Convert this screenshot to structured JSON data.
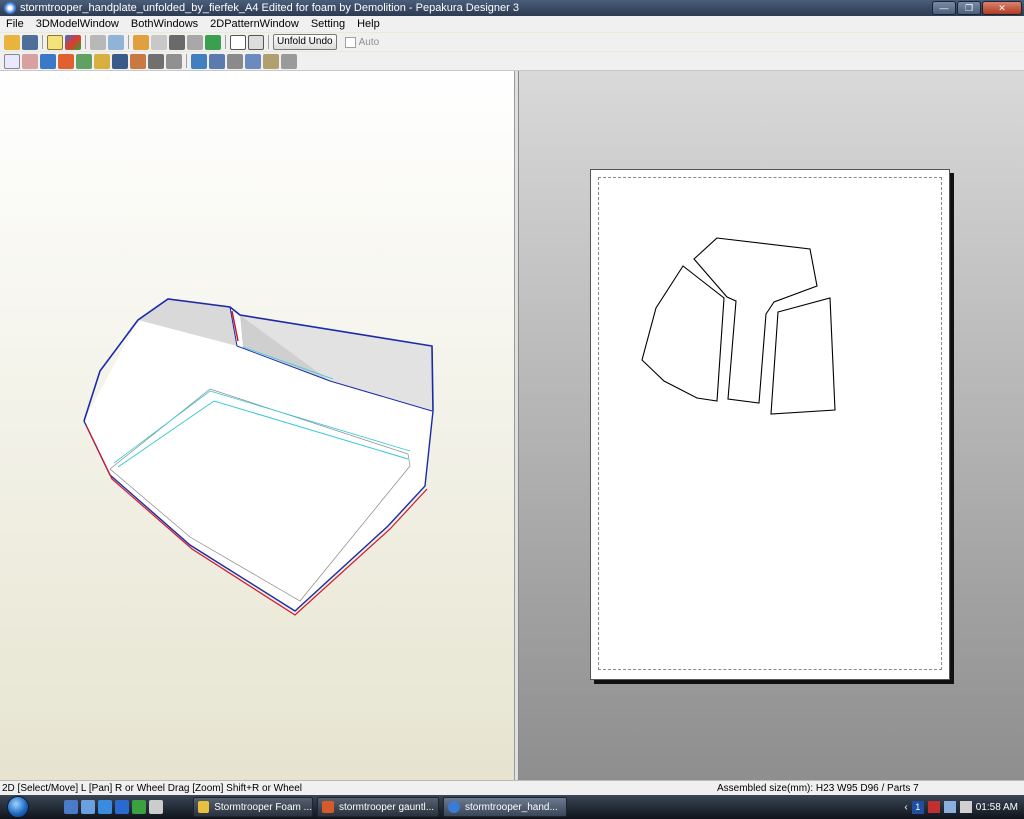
{
  "window": {
    "title": "stormtrooper_handplate_unfolded_by_fierfek_A4 Edited for foam by Demolition - Pepakura Designer 3"
  },
  "menu": [
    "File",
    "3DModelWindow",
    "BothWindows",
    "2DPatternWindow",
    "Setting",
    "Help"
  ],
  "toolbar": {
    "unfold_undo_label": "Unfold Undo",
    "auto_label": "Auto"
  },
  "status": {
    "left": "2D [Select/Move] L [Pan] R or Wheel Drag [Zoom] Shift+R or Wheel",
    "right": "Assembled size(mm): H23 W95 D96 / Parts 7"
  },
  "taskbar": {
    "tasks": [
      "Stormtrooper Foam ...",
      "stormtrooper gauntl...",
      "stormtrooper_hand..."
    ],
    "clock": "01:58 AM",
    "tray_indicator": "1"
  }
}
